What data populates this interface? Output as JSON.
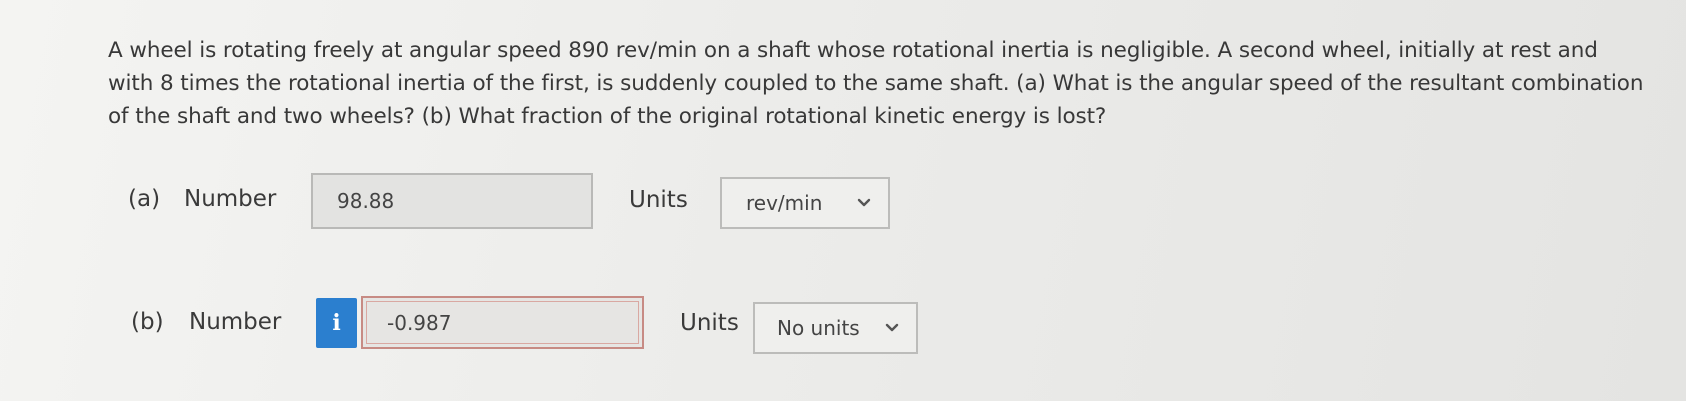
{
  "question": {
    "text": "A wheel is rotating freely at angular speed 890 rev/min on a shaft whose rotational inertia is negligible. A second wheel, initially at rest and with 8 times the rotational inertia of the first, is suddenly coupled to the same shaft. (a) What is the angular speed of the resultant combination of the shaft and two wheels? (b) What fraction of the original rotational kinetic energy is lost?"
  },
  "part_a": {
    "label": "(a)",
    "number_label": "Number",
    "answer_value": "98.88",
    "units_label": "Units",
    "units_selected": "rev/min",
    "chevron_icon": "chevron-down-icon"
  },
  "part_b": {
    "label": "(b)",
    "number_label": "Number",
    "info_icon": "info-icon",
    "info_glyph": "i",
    "info_color": "#2b7fcf",
    "answer_value": "-0.987",
    "answer_border_color": "#c78b84",
    "units_label": "Units",
    "units_selected": "No units",
    "chevron_icon": "chevron-down-icon"
  }
}
